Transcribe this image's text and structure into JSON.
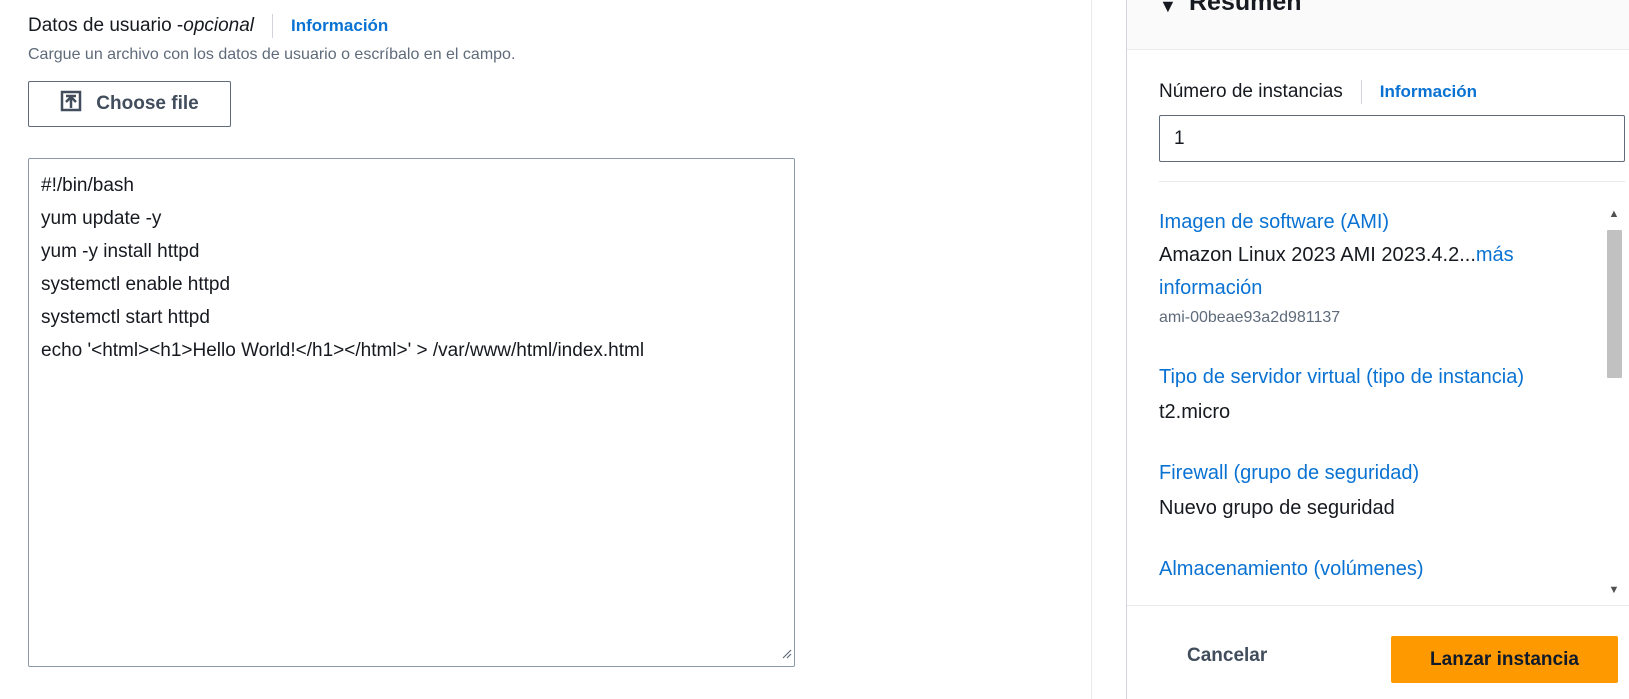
{
  "user_data": {
    "label": "Datos de usuario - ",
    "optional": "opcional",
    "info_link": "Información",
    "description": "Cargue un archivo con los datos de usuario o escríbalo en el campo.",
    "choose_file_button": "Choose file",
    "script_lines": [
      "#!/bin/bash",
      "yum update -y",
      "yum -y install httpd",
      "systemctl enable httpd",
      "systemctl start httpd",
      "echo '<html><h1>Hello World!</h1></html>' > /var/www/html/index.html"
    ]
  },
  "summary": {
    "title": "Resumen",
    "instance_count_label": "Número de instancias",
    "instance_count_info": "Información",
    "instance_count_value": "1",
    "ami_label": "Imagen de software (AMI)",
    "ami_value": "Amazon Linux 2023 AMI 2023.4.2...",
    "ami_more_link_a": "más",
    "ami_more_link_b": "información",
    "ami_id": "ami-00beae93a2d981137",
    "instance_type_label": "Tipo de servidor virtual (tipo de instancia)",
    "instance_type_value": "t2.micro",
    "firewall_label": "Firewall (grupo de seguridad)",
    "firewall_value": "Nuevo grupo de seguridad",
    "storage_label": "Almacenamiento (volúmenes)",
    "cancel_button": "Cancelar",
    "launch_button": "Lanzar instancia"
  },
  "colors": {
    "link": "#0972d3",
    "primary_button": "#ff9900"
  }
}
